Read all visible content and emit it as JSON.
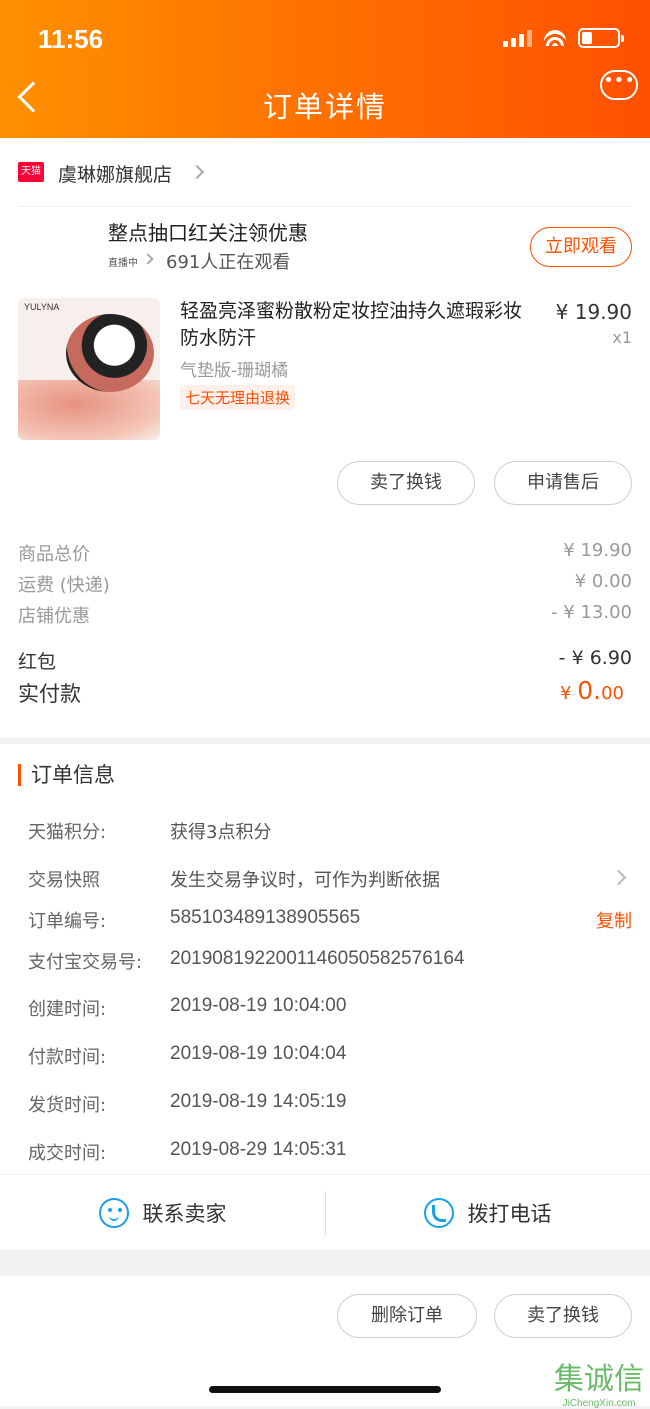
{
  "status_bar": {
    "time": "11:56"
  },
  "header": {
    "title": "订单详情",
    "more_glyph": "•••"
  },
  "store": {
    "badge": "天猫",
    "name": "虞琳娜旗舰店"
  },
  "live": {
    "title": "整点抽口红关注领优惠",
    "tag": "直播中",
    "viewers": "691人正在观看",
    "watch_label": "立即观看"
  },
  "product": {
    "brand_mark": "YULYNA",
    "name": "轻盈亮泽蜜粉散粉定妆控油持久遮瑕彩妆防水防汗",
    "price": "¥ 19.90",
    "quantity": "x1",
    "sku": "气垫版-珊瑚橘",
    "badge": "七天无理由退换"
  },
  "product_actions": {
    "sell_label": "卖了换钱",
    "aftersale_label": "申请售后"
  },
  "summary": {
    "rows": [
      {
        "label": "商品总价",
        "value": "¥ 19.90"
      },
      {
        "label": "运费 (快递)",
        "value": "¥ 0.00"
      },
      {
        "label": "店铺优惠",
        "value": "- ¥ 13.00"
      }
    ],
    "redpacket": {
      "label": "红包",
      "value": "- ¥ 6.90"
    },
    "paid": {
      "label": "实付款",
      "currency": "¥",
      "int": "0.",
      "dec": "00"
    }
  },
  "order_info": {
    "title": "订单信息",
    "rows": [
      {
        "label": "天猫积分:",
        "value": "获得3点积分"
      },
      {
        "label": "交易快照",
        "value": "发生交易争议时，可作为判断依据"
      },
      {
        "label": "订单编号:",
        "value": "585103489138905565",
        "action": "复制"
      },
      {
        "label": "支付宝交易号:",
        "value": "2019081922001146050582576164"
      },
      {
        "label": "创建时间:",
        "value": "2019-08-19 10:04:00"
      },
      {
        "label": "付款时间:",
        "value": "2019-08-19 10:04:04"
      },
      {
        "label": "发货时间:",
        "value": "2019-08-19 14:05:19"
      },
      {
        "label": "成交时间:",
        "value": "2019-08-29 14:05:31"
      }
    ]
  },
  "contact": {
    "seller_label": "联系卖家",
    "phone_label": "拨打电话"
  },
  "bottom_actions": {
    "delete_label": "删除订单",
    "sell_label": "卖了换钱"
  },
  "watermark": {
    "text": "集诚信",
    "url": "JiChengXin.com"
  },
  "colors": {
    "accent": "#ff5000",
    "header_start": "#ff9000",
    "link_icon": "#1aa0e8"
  }
}
